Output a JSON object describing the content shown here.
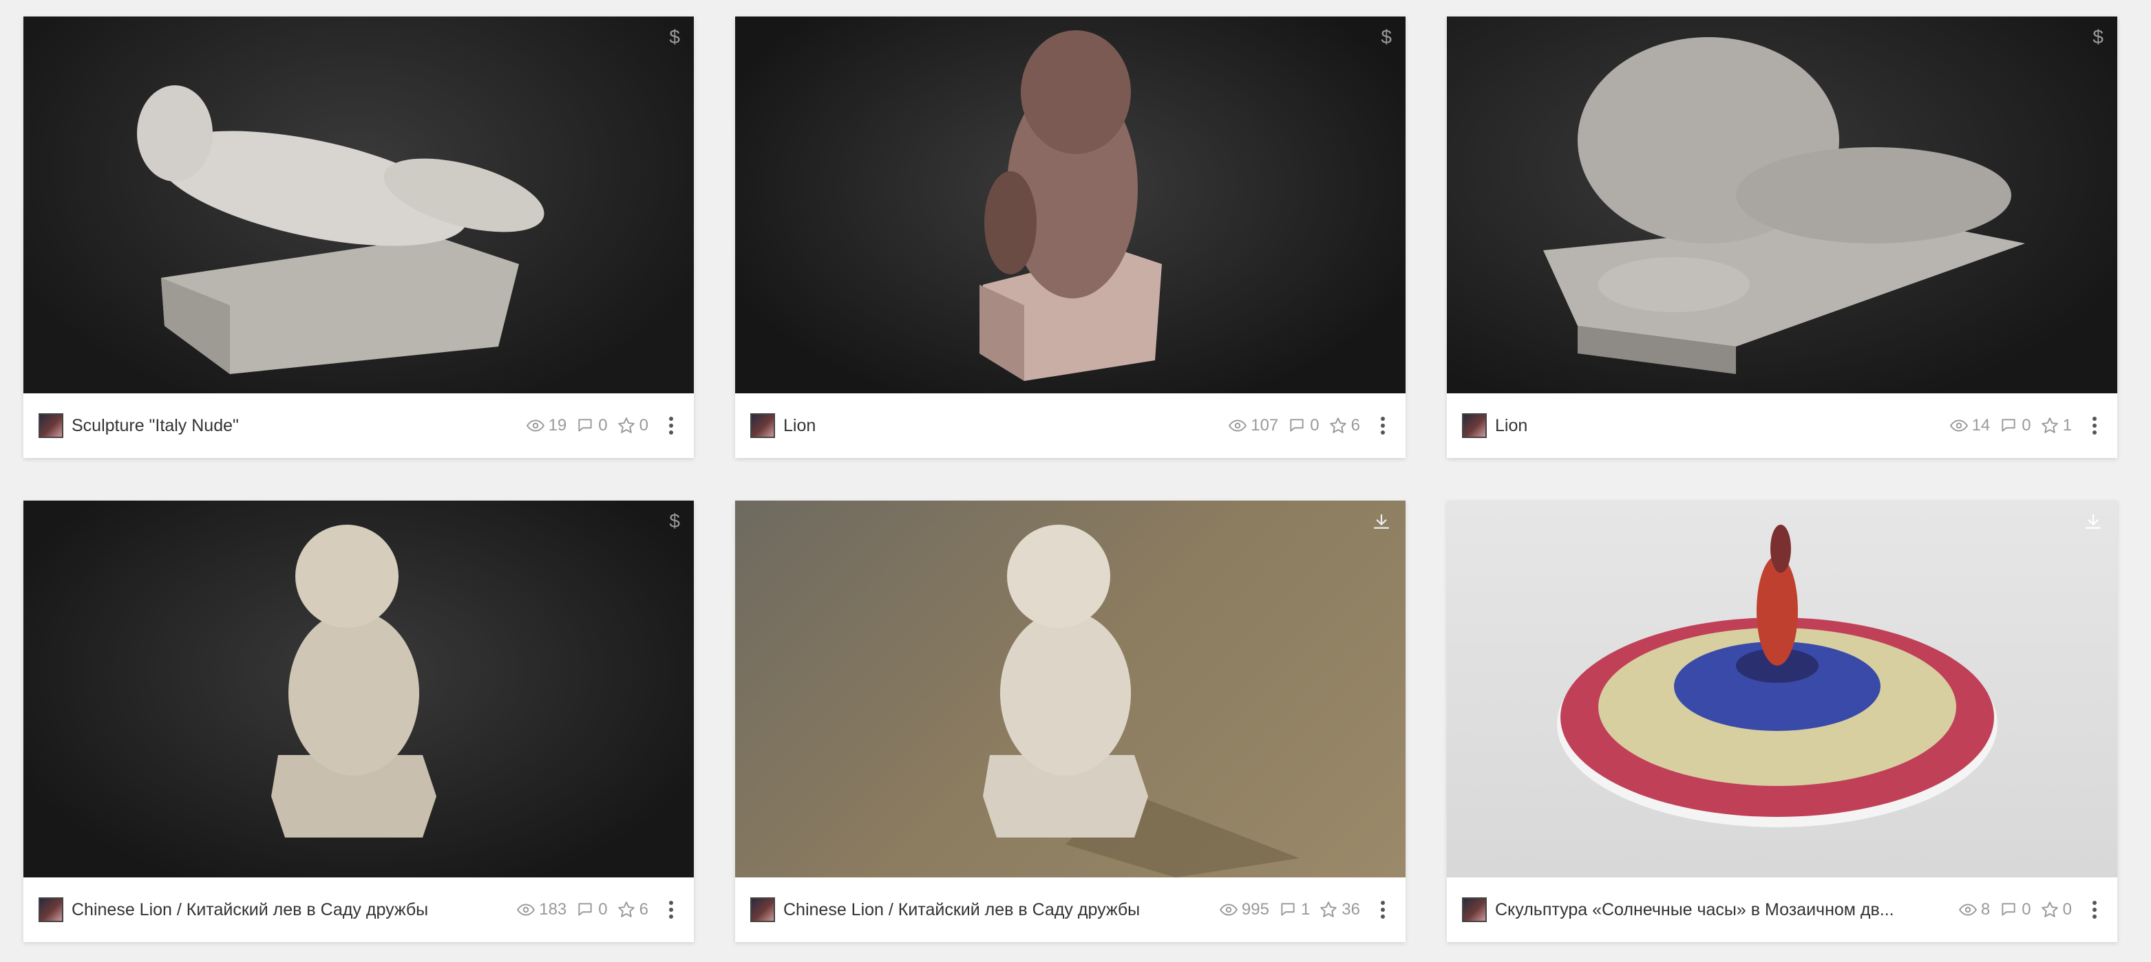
{
  "cards": [
    {
      "title": "Sculpture \"Italy Nude\"",
      "views": "19",
      "comments": "0",
      "likes": "0",
      "badge": "price-icon",
      "badge_text": "$",
      "thumb_style": "dark"
    },
    {
      "title": "Lion",
      "views": "107",
      "comments": "0",
      "likes": "6",
      "badge": "price-icon",
      "badge_text": "$",
      "thumb_style": "dark"
    },
    {
      "title": "Lion",
      "views": "14",
      "comments": "0",
      "likes": "1",
      "badge": "price-icon",
      "badge_text": "$",
      "thumb_style": "dark"
    },
    {
      "title": "Chinese Lion / Китайский лев в Саду дружбы",
      "views": "183",
      "comments": "0",
      "likes": "6",
      "badge": "price-icon",
      "badge_text": "$",
      "thumb_style": "dark"
    },
    {
      "title": "Chinese Lion / Китайский лев в Саду дружбы",
      "views": "995",
      "comments": "1",
      "likes": "36",
      "badge": "download-icon",
      "badge_text": "",
      "thumb_style": "tan"
    },
    {
      "title": "Скульптура «Солнечные часы» в Мозаичном дв...",
      "views": "8",
      "comments": "0",
      "likes": "0",
      "badge": "download-icon",
      "badge_text": "",
      "thumb_style": "light"
    }
  ],
  "colors": {
    "dark_bg": "#1e1e1e",
    "tan_bg": "#8a7a5e",
    "light_bg": "#e2e2e2",
    "stone": "#cfccc6"
  }
}
